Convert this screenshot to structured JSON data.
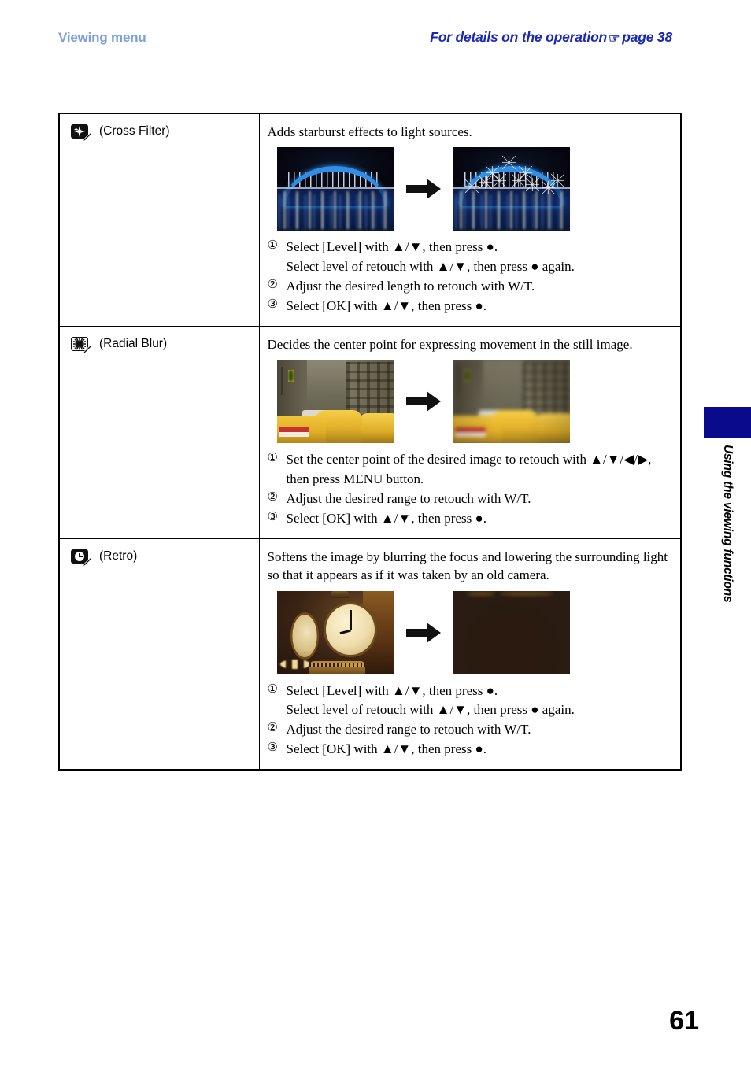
{
  "header": {
    "left_title": "Viewing menu",
    "right_title_before": "For details on the operation",
    "right_icon": "pointing-hand-icon",
    "right_icon_glyph": "☞",
    "right_title_after": "page 38"
  },
  "side_tab": {
    "label": "Using the viewing functions",
    "color": "#0a0a8c"
  },
  "folio": "61",
  "colors": {
    "running_head_left": "#7c9fe0",
    "running_head_right": "#1b28b4",
    "tab": "#0a0a8c",
    "rule": "#000000"
  },
  "table": {
    "rows": [
      {
        "icon_name": "cross-filter-icon",
        "name": "(Cross Filter)",
        "description": "Adds starburst effects to light sources.",
        "samples": {
          "before_alt": "night-bridge-photo-before",
          "after_alt": "night-bridge-photo-after",
          "arrow": "right-arrow-icon"
        },
        "steps": [
          {
            "num": "①",
            "text": "Select [Level] with ▲/▼, then press ●.",
            "sub": "Select level of retouch with ▲/▼, then press ● again."
          },
          {
            "num": "②",
            "text": "Adjust the desired length to retouch with W/T."
          },
          {
            "num": "③",
            "text": "Select [OK] with ▲/▼, then press ●."
          }
        ]
      },
      {
        "icon_name": "radial-blur-icon",
        "name": "(Radial Blur)",
        "description": "Decides the center point for expressing movement in the still image.",
        "samples": {
          "before_alt": "taxi-street-photo-before",
          "after_alt": "taxi-street-photo-after",
          "arrow": "right-arrow-icon"
        },
        "steps": [
          {
            "num": "①",
            "text": "Set the center point of the desired image to retouch with ▲/▼/◀/▶, then press MENU button."
          },
          {
            "num": "②",
            "text": "Adjust the desired range to retouch with W/T."
          },
          {
            "num": "③",
            "text": "Select [OK] with ▲/▼, then press ●."
          }
        ]
      },
      {
        "icon_name": "retro-icon",
        "name": "(Retro)",
        "description": "Softens the image by blurring the focus and lowering the surrounding light so that it appears as if it was taken by an old camera.",
        "samples": {
          "before_alt": "station-clock-photo-before",
          "after_alt": "station-clock-photo-after",
          "arrow": "right-arrow-icon"
        },
        "steps": [
          {
            "num": "①",
            "text": "Select [Level] with ▲/▼, then press ●.",
            "sub": "Select level of retouch with ▲/▼, then press ● again."
          },
          {
            "num": "②",
            "text": "Adjust the desired range to retouch with W/T."
          },
          {
            "num": "③",
            "text": "Select [OK] with ▲/▼, then press ●."
          }
        ]
      }
    ]
  }
}
